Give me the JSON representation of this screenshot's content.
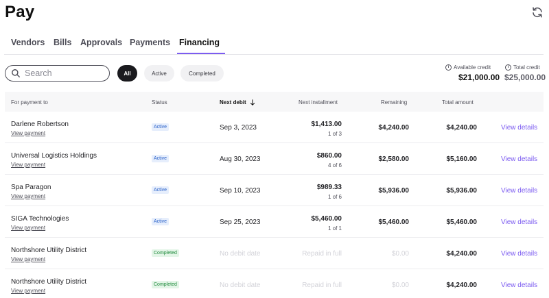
{
  "page": {
    "title": "Pay"
  },
  "tabs": [
    "Vendors",
    "Bills",
    "Approvals",
    "Payments",
    "Financing"
  ],
  "active_tab": "Financing",
  "search": {
    "placeholder": "Search",
    "value": ""
  },
  "filters": {
    "all": "All",
    "active": "Active",
    "completed": "Completed",
    "selected": "All"
  },
  "credit": {
    "available_label": "Available credit",
    "available_value": "$21,000.00",
    "total_label": "Total credit",
    "total_value": "$25,000.00"
  },
  "table": {
    "headers": {
      "payee": "For payment to",
      "status": "Status",
      "next_debit": "Next debit",
      "next_installment": "Next installment",
      "remaining": "Remaining",
      "total": "Total amount"
    },
    "rows": [
      {
        "payee": "Darlene Robertson",
        "view_payment": "View payment",
        "status": "Active",
        "next_debit": "Sep 3, 2023",
        "installment_amount": "$1,413.00",
        "installment_of": "1 of 3",
        "remaining": "$4,240.00",
        "total": "$4,240.00",
        "view_details": "View details"
      },
      {
        "payee": "Universal Logistics Holdings",
        "view_payment": "View payment",
        "status": "Active",
        "next_debit": "Aug 30, 2023",
        "installment_amount": "$860.00",
        "installment_of": "4 of 6",
        "remaining": "$2,580.00",
        "total": "$5,160.00",
        "view_details": "View details"
      },
      {
        "payee": "Spa Paragon",
        "view_payment": "View payment",
        "status": "Active",
        "next_debit": "Sep 10, 2023",
        "installment_amount": "$989.33",
        "installment_of": "1 of 6",
        "remaining": "$5,936.00",
        "total": "$5,936.00",
        "view_details": "View details"
      },
      {
        "payee": "SIGA Technologies",
        "view_payment": "View payment",
        "status": "Active",
        "next_debit": "Sep 25, 2023",
        "installment_amount": "$5,460.00",
        "installment_of": "1 of 1",
        "remaining": "$5,460.00",
        "total": "$5,460.00",
        "view_details": "View details"
      },
      {
        "payee": "Northshore Utility District",
        "view_payment": "View payment",
        "status": "Completed",
        "next_debit": "No debit date",
        "installment_amount": "Repaid in full",
        "installment_of": "",
        "remaining": "$0.00",
        "total": "$4,240.00",
        "view_details": "View details"
      },
      {
        "payee": "Northshore Utility District",
        "view_payment": "View payment",
        "status": "Completed",
        "next_debit": "No debit date",
        "installment_amount": "Repaid in full",
        "installment_of": "",
        "remaining": "$0.00",
        "total": "$4,240.00",
        "view_details": "View details"
      }
    ]
  },
  "colors": {
    "accent": "#7c5cf0",
    "active_badge_bg": "#e6eefc",
    "completed_badge_bg": "#e3f5e7"
  },
  "icons": {
    "refresh": "refresh-icon",
    "search": "search-icon",
    "sort": "arrow-down-icon",
    "info": "info-icon"
  }
}
